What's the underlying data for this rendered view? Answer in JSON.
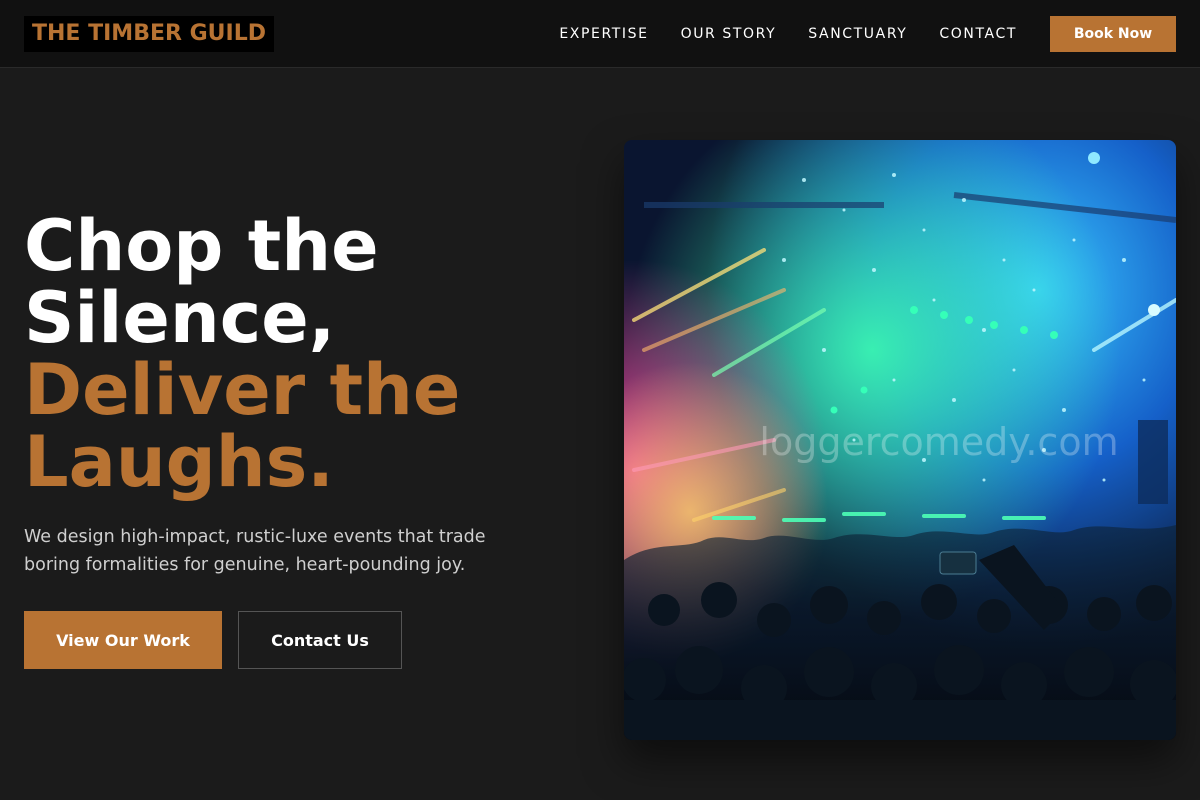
{
  "brand": {
    "name": "THE TIMBER GUILD"
  },
  "nav": {
    "items": [
      {
        "label": "EXPERTISE"
      },
      {
        "label": "OUR STORY"
      },
      {
        "label": "SANCTUARY"
      },
      {
        "label": "CONTACT"
      }
    ],
    "cta_label": "Book Now"
  },
  "hero": {
    "title_lines": [
      "Chop the",
      "Silence,"
    ],
    "accent_lines": [
      "Deliver the",
      "Laughs."
    ],
    "subtitle": "We design high-impact, rustic-luxe events that trade boring formalities for genuine, heart-pounding joy.",
    "primary_cta": "View Our Work",
    "secondary_cta": "Contact Us",
    "image": {
      "description_icon": "concert-crowd-image",
      "watermark": "loggercomedy.com"
    }
  },
  "colors": {
    "accent": "#b87333",
    "background": "#1b1b1b",
    "topbar": "#111111"
  }
}
